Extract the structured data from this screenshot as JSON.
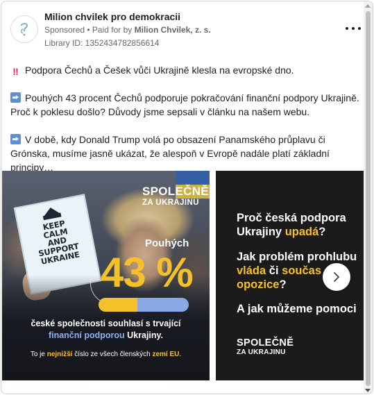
{
  "post": {
    "page_name": "Milion chvilek pro demokracii",
    "sponsored": "Sponsored",
    "paid_for_by_prefix": " • Paid for by ",
    "paid_for_by": "Milion Chvilek, z. s.",
    "library_id": "Library ID: 1352434782856614",
    "more_icon": "more-horizontal-icon",
    "paragraphs": [
      {
        "icon": "double-exclamation-icon",
        "text": "Podpora Čechů a Češek vůči Ukrajině klesla na evropské dno."
      },
      {
        "icon": "right-arrow-icon",
        "text": "Pouhých 43 procent Čechů podporuje pokračování finanční podpory Ukrajině. Proč k poklesu došlo? Důvody jsme sepsali v článku na našem webu."
      },
      {
        "icon": "right-arrow-icon",
        "text": "V době, kdy Donald Trump volá po obsazení Panamského průplavu či Grónska, musíme jasně ukázat, že alespoň v Evropě nadále platí základní principy…"
      }
    ]
  },
  "slide1": {
    "sign_lines": [
      "KEEP",
      "CALM",
      "AND",
      "SUPPORT",
      "UKRAINE"
    ],
    "brand_l1": "SPOLEČNĚ",
    "brand_l2": "ZA UKRAJINU",
    "pouhych": "Pouhých",
    "percent": "43 %",
    "progress_value": 0.43,
    "line1": "české společnosti souhlasí s trvající",
    "line2_blue": "finanční podporou",
    "line2_rest": " Ukrajiny.",
    "foot_a": "To je ",
    "foot_b": "nejnižší",
    "foot_c": " číslo ze všech členských ",
    "foot_d": "zemí EU",
    "foot_e": ".",
    "colors": {
      "yellow": "#f4c12a",
      "blue": "#8fb0f0"
    }
  },
  "slide2": {
    "q1_a": "Proč česká podpora",
    "q1_b": "Ukrajiny ",
    "q1_c": "upadá",
    "q1_d": "?",
    "q2_a": "Jak problém prohlubu",
    "q2_b": "vláda",
    "q2_c": " či ",
    "q2_d": "součas",
    "q2_e": "opozice",
    "q2_f": "?",
    "q3": "A jak můžeme pomoci",
    "brand_l1": "SPOLEČNĚ",
    "brand_l2": "ZA UKRAJINU"
  },
  "carousel": {
    "next_icon": "chevron-right-icon"
  }
}
